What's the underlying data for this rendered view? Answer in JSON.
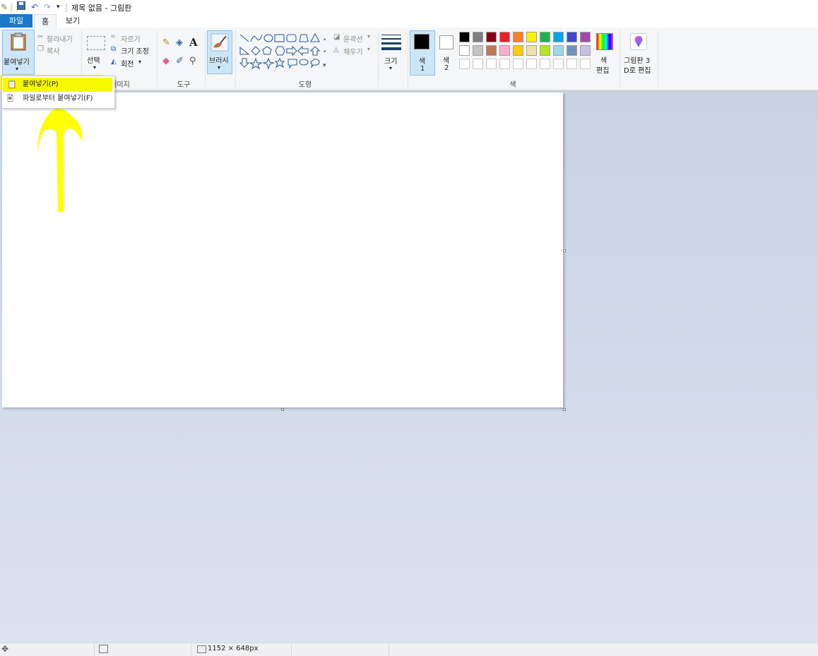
{
  "window": {
    "title": "제목 없음 - 그림판"
  },
  "tabs": [
    {
      "label": "파일"
    },
    {
      "label": "홈"
    },
    {
      "label": "보기"
    }
  ],
  "ribbon": {
    "clipboard": {
      "paste": "붙여넣기",
      "cut": "잘라내기",
      "copy": "복사"
    },
    "image": {
      "select": "선택",
      "crop": "자르기",
      "resize": "크기 조정",
      "rotate": "회전",
      "label": "이미지"
    },
    "tools": {
      "label": "도구"
    },
    "brush": {
      "label": "브러시"
    },
    "shapes": {
      "outline": "윤곽선",
      "fill": "채우기",
      "label": "도형"
    },
    "size": {
      "label": "크기"
    },
    "colors": {
      "color1_line1": "색",
      "color1_line2": "1",
      "color2_line1": "색",
      "color2_line2": "2",
      "edit_line1": "색",
      "edit_line2": "편집",
      "paint3d_line1": "그림판 3",
      "paint3d_line2": "D로 편집",
      "label": "색",
      "palette_row1": [
        "#000000",
        "#7f7f7f",
        "#880015",
        "#ed1c24",
        "#ff7f27",
        "#fff200",
        "#22b14c",
        "#00a2e8",
        "#3f48cc",
        "#a349a4"
      ],
      "palette_row2": [
        "#ffffff",
        "#c3c3c3",
        "#b97a57",
        "#ffaec9",
        "#ffc90e",
        "#efe4b0",
        "#b5e61d",
        "#99d9ea",
        "#7092be",
        "#c8bfe7"
      ],
      "primary": "#000000",
      "secondary": "#ffffff"
    }
  },
  "paste_menu": {
    "items": [
      {
        "label": "붙여넣기(P)",
        "highlighted": true
      },
      {
        "label": "파일로부터 붙여넣기(F)"
      }
    ]
  },
  "statusbar": {
    "image_size": "1152 × 648px"
  },
  "annotation": {
    "color": "#ffff00"
  }
}
